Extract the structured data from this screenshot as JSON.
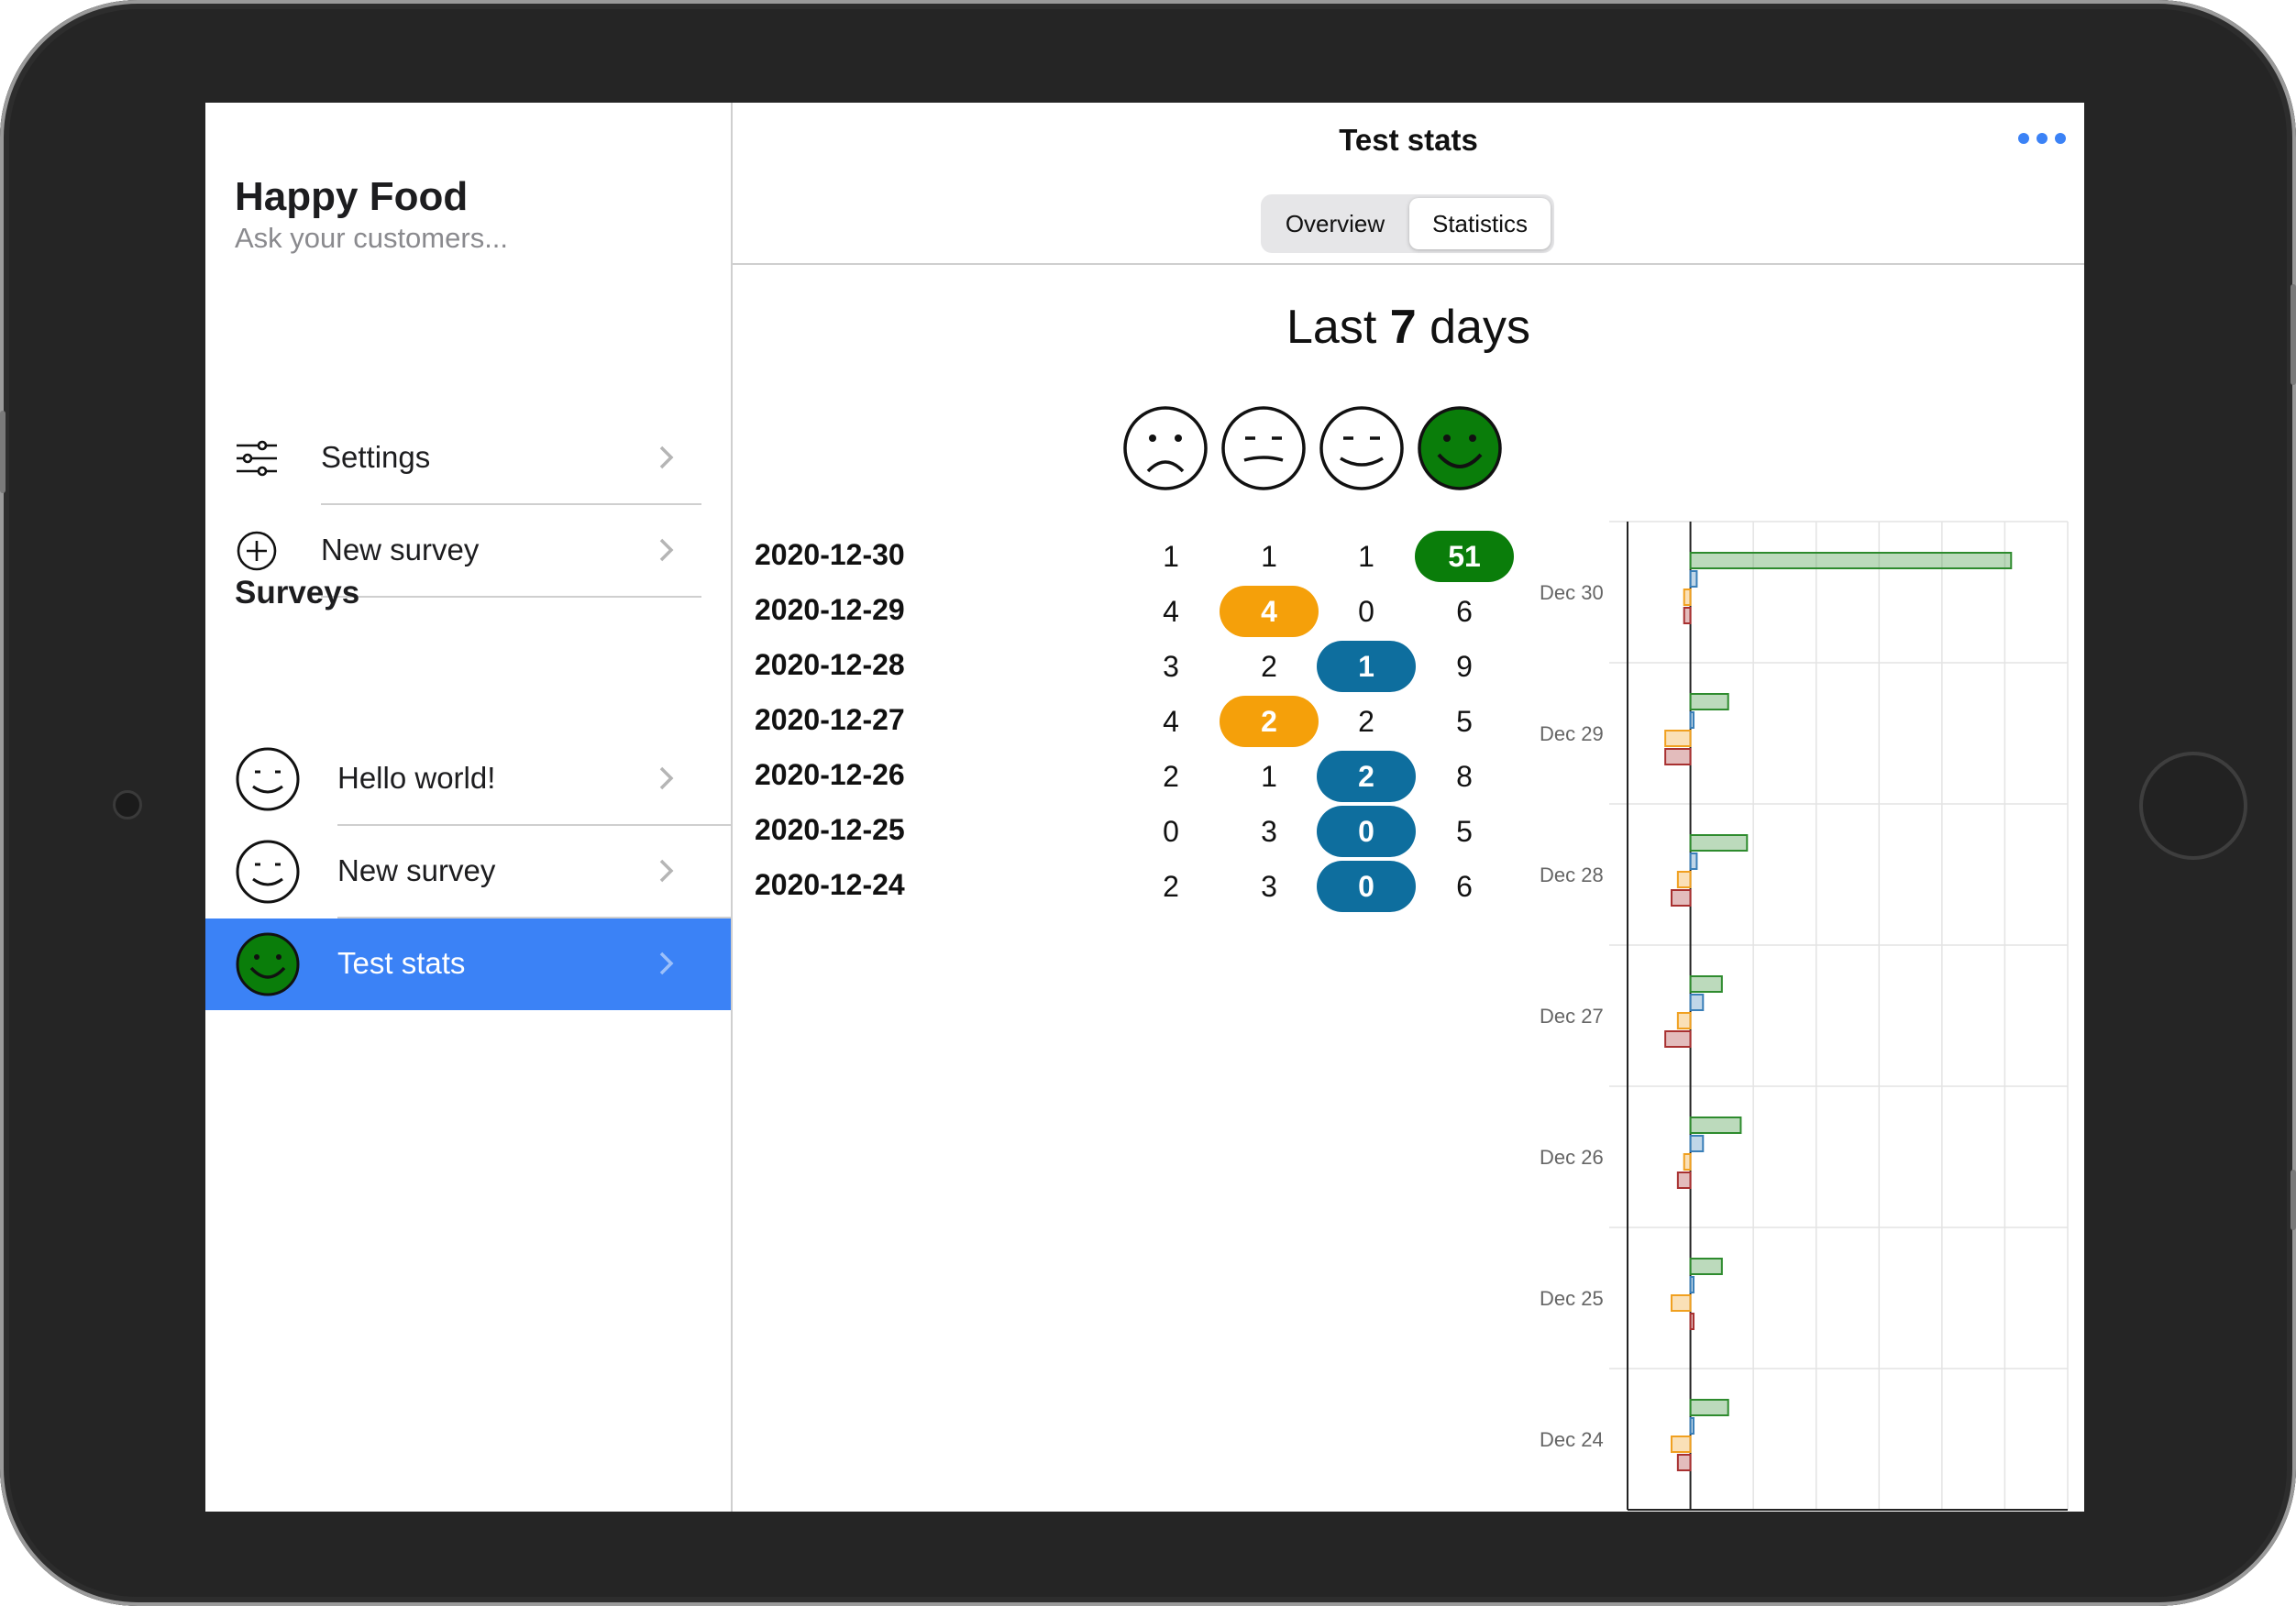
{
  "sidebar": {
    "title": "Happy Food",
    "subtitle": "Ask your customers...",
    "menu": [
      {
        "label": "Settings",
        "icon": "sliders-icon"
      },
      {
        "label": "New survey",
        "icon": "plus-circle-icon"
      }
    ],
    "surveys_heading": "Surveys",
    "surveys": [
      {
        "label": "Hello world!",
        "icon": "smiley-icon",
        "active": false
      },
      {
        "label": "New survey",
        "icon": "smiley-icon",
        "active": false
      },
      {
        "label": "Test stats",
        "icon": "green-smiley-icon",
        "active": true
      }
    ]
  },
  "header": {
    "title": "Test stats",
    "more_icon": "ellipsis-icon",
    "segments": [
      "Overview",
      "Statistics"
    ],
    "selected_segment": "Statistics"
  },
  "stats": {
    "heading_prefix": "Last",
    "heading_number": "7",
    "heading_suffix": "days",
    "face_icons": [
      "sad-face-icon",
      "neutral-face-icon",
      "smile-face-icon",
      "happy-face-icon"
    ],
    "rows": [
      {
        "date": "2020-12-30",
        "values": [
          "1",
          "1",
          "1",
          "51"
        ],
        "highlight": 3
      },
      {
        "date": "2020-12-29",
        "values": [
          "4",
          "4",
          "0",
          "6"
        ],
        "highlight": 1
      },
      {
        "date": "2020-12-28",
        "values": [
          "3",
          "2",
          "1",
          "9"
        ],
        "highlight": 2
      },
      {
        "date": "2020-12-27",
        "values": [
          "4",
          "2",
          "2",
          "5"
        ],
        "highlight": 1
      },
      {
        "date": "2020-12-26",
        "values": [
          "2",
          "1",
          "2",
          "8"
        ],
        "highlight": 2
      },
      {
        "date": "2020-12-25",
        "values": [
          "0",
          "3",
          "0",
          "5"
        ],
        "highlight": 2
      },
      {
        "date": "2020-12-24",
        "values": [
          "2",
          "3",
          "0",
          "6"
        ],
        "highlight": 2
      }
    ]
  },
  "colors": {
    "accent": "#3b82f6",
    "happy": "#0a7d0a",
    "smile": "#0e6e9e",
    "neutral": "#f5a00a",
    "sad": "#b84848"
  },
  "chart_data": {
    "type": "bar",
    "orientation": "horizontal",
    "categories": [
      "Dec 30",
      "Dec 29",
      "Dec 28",
      "Dec 27",
      "Dec 26",
      "Dec 25",
      "Dec 24"
    ],
    "series": [
      {
        "values": [
          51,
          6,
          9,
          5,
          8,
          5,
          6
        ],
        "color": "#2e8b2e"
      },
      {
        "values": [
          1,
          0.5,
          1,
          2,
          2,
          0.5,
          0.5
        ],
        "color": "#3a7fb8"
      },
      {
        "values": [
          -1,
          -4,
          -2,
          -2,
          -1,
          -3,
          -3
        ],
        "color": "#f0a020"
      },
      {
        "values": [
          -1,
          -4,
          -3,
          -4,
          -2,
          0.5,
          -2
        ],
        "color": "#a83030"
      }
    ],
    "xlim": [
      -10,
      60
    ],
    "xticks": [
      "10",
      "0",
      "10",
      "20",
      "30",
      "40",
      "50",
      "60"
    ],
    "xtick_values": [
      -10,
      0,
      10,
      20,
      30,
      40,
      50,
      60
    ],
    "grid": true
  }
}
